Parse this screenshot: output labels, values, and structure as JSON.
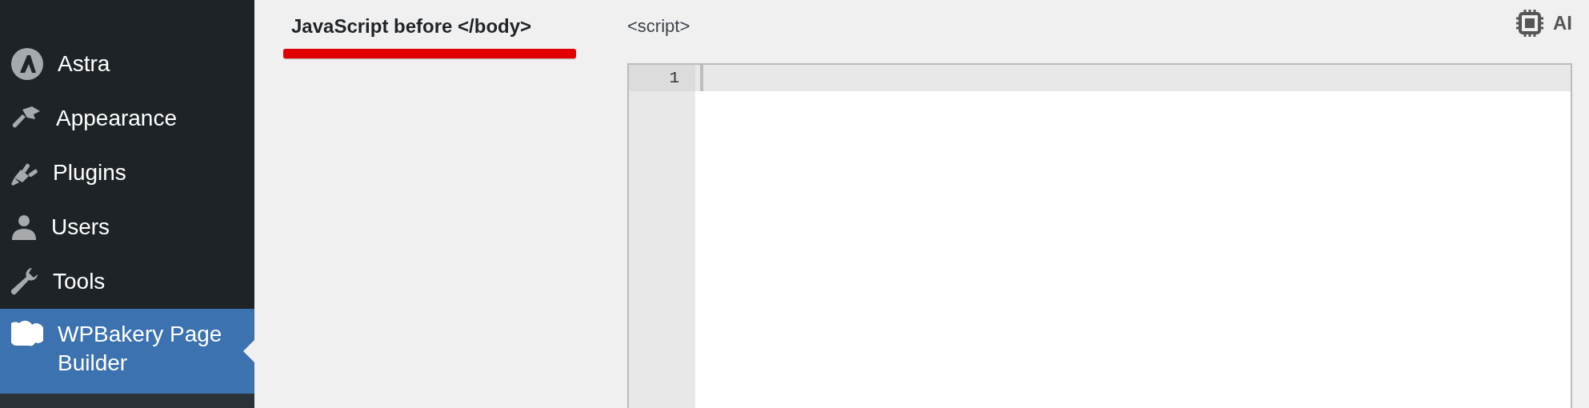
{
  "sidebar": {
    "items": [
      {
        "label": "Astra",
        "selected": false
      },
      {
        "label": "Appearance",
        "selected": false
      },
      {
        "label": "Plugins",
        "selected": false
      },
      {
        "label": "Users",
        "selected": false
      },
      {
        "label": "Tools",
        "selected": false
      },
      {
        "label": "WPBakery Page Builder",
        "selected": true
      }
    ]
  },
  "section": {
    "label": "JavaScript before </body>"
  },
  "editor": {
    "tag": "<script>",
    "ai_button": "AI",
    "line_numbers": [
      "1"
    ]
  }
}
